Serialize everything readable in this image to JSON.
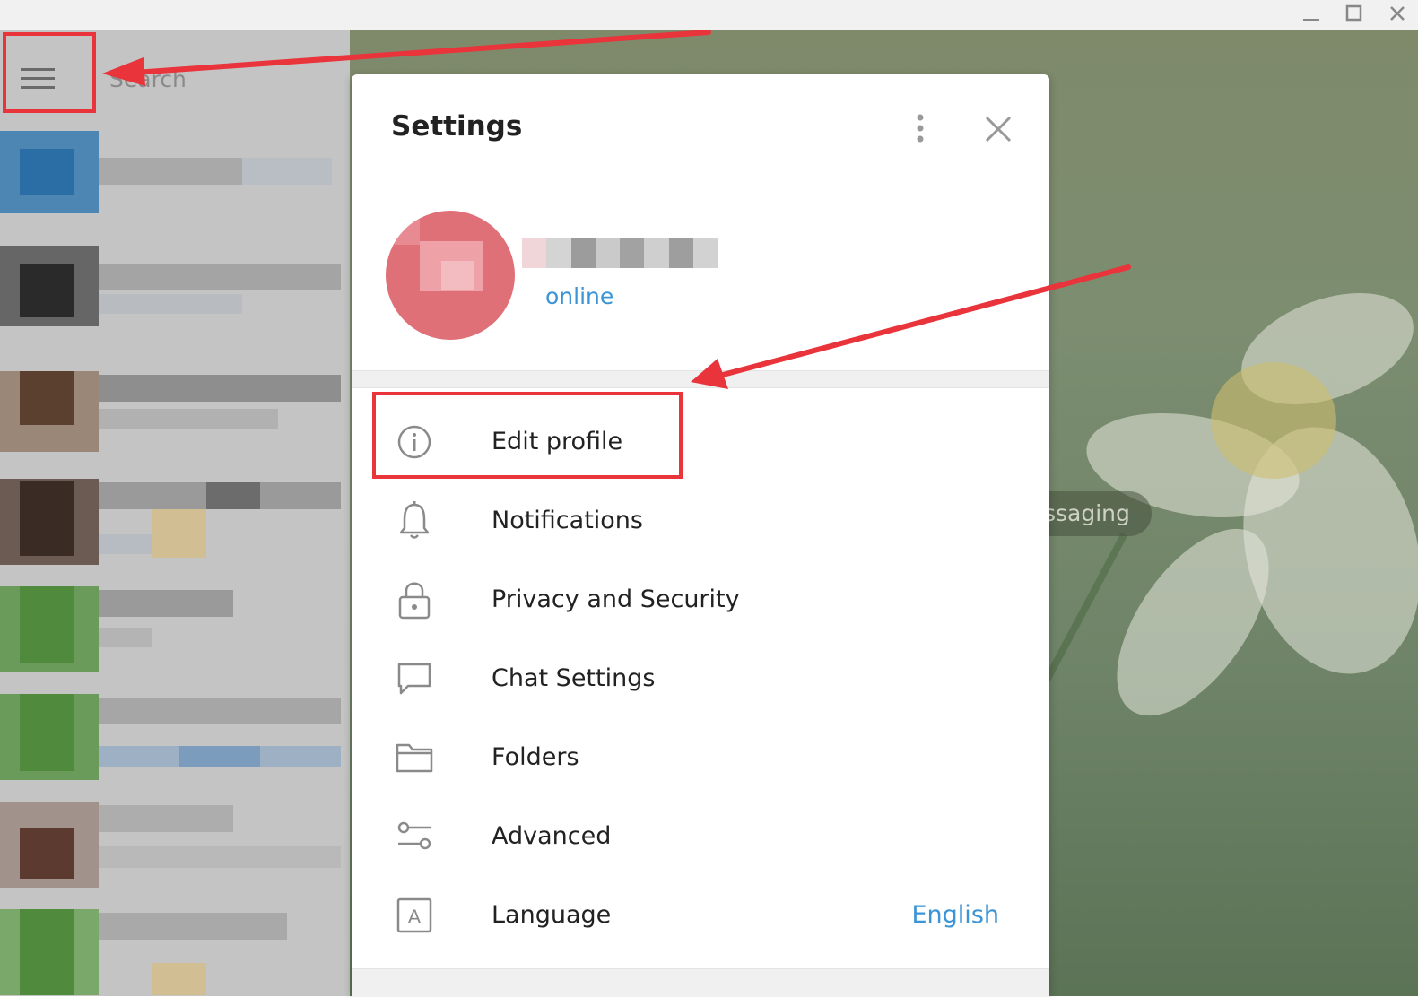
{
  "window": {
    "controls": [
      "minimize-icon",
      "maximize-icon",
      "close-icon"
    ]
  },
  "sidebar": {
    "menu_icon": "hamburger-menu-icon",
    "search_placeholder": "Search"
  },
  "background": {
    "service_pill": "ssaging"
  },
  "settings": {
    "title": "Settings",
    "more_icon": "more-vertical-icon",
    "close_icon": "close-icon",
    "profile": {
      "status": "online"
    },
    "items": [
      {
        "label": "Edit profile",
        "icon": "info-icon"
      },
      {
        "label": "Notifications",
        "icon": "bell-icon"
      },
      {
        "label": "Privacy and Security",
        "icon": "lock-icon"
      },
      {
        "label": "Chat Settings",
        "icon": "chat-bubble-icon"
      },
      {
        "label": "Folders",
        "icon": "folder-icon"
      },
      {
        "label": "Advanced",
        "icon": "sliders-icon"
      },
      {
        "label": "Language",
        "icon": "language-icon",
        "value": "English"
      }
    ]
  },
  "colors": {
    "accent": "#3a94d6",
    "annotation": "#e8343a",
    "avatar": "#e07077"
  }
}
